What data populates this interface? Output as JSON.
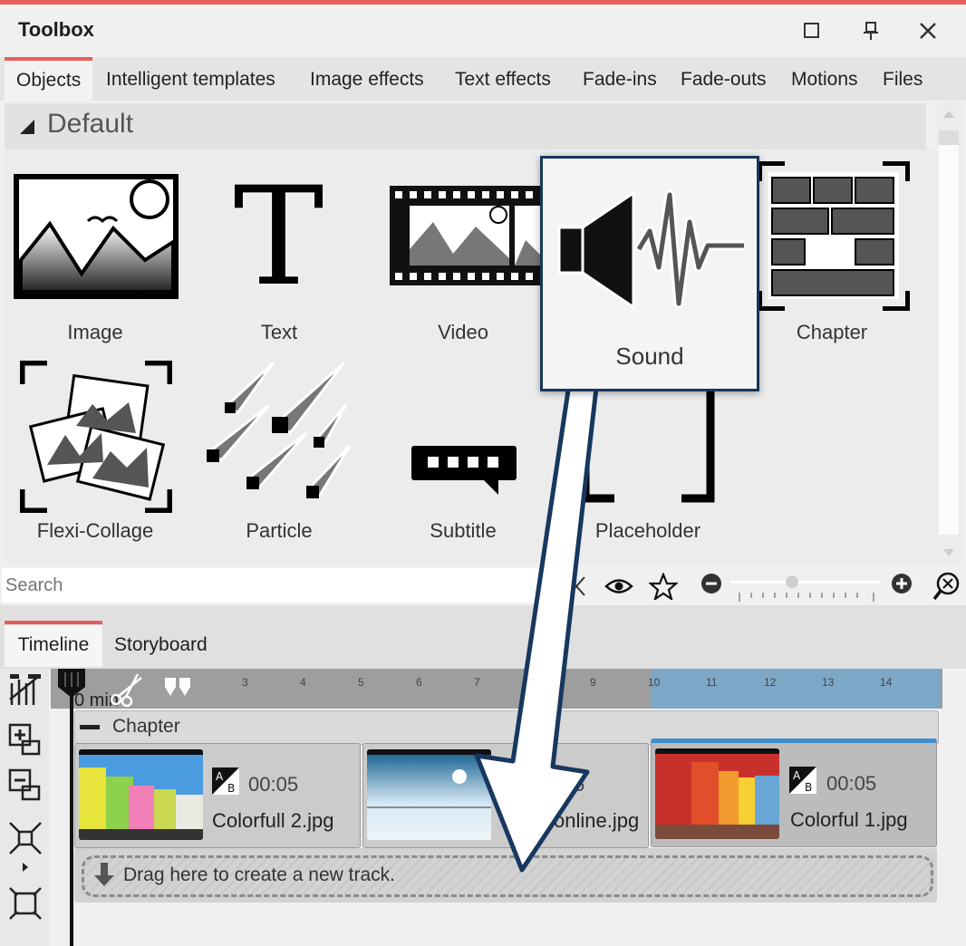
{
  "window": {
    "title": "Toolbox",
    "maximize_icon": "square-icon",
    "pin_icon": "pin-icon",
    "close_icon": "close-icon"
  },
  "tabs": [
    "Objects",
    "Intelligent templates",
    "Image effects",
    "Text effects",
    "Fade-ins",
    "Fade-outs",
    "Motions",
    "Files"
  ],
  "active_tab": "Objects",
  "group": {
    "label": "Default",
    "collapse_icon": "triangle-icon"
  },
  "objects": [
    {
      "label": "Image",
      "icon": "image-icon"
    },
    {
      "label": "Text",
      "icon": "text-icon"
    },
    {
      "label": "Video",
      "icon": "video-icon"
    },
    {
      "label": "Sound",
      "icon": "sound-icon"
    },
    {
      "label": "Chapter",
      "icon": "chapter-icon"
    },
    {
      "label": "Flexi-Collage",
      "icon": "collage-icon"
    },
    {
      "label": "Particle",
      "icon": "particle-icon"
    },
    {
      "label": "Subtitle",
      "icon": "subtitle-icon"
    },
    {
      "label": "Placeholder",
      "icon": "placeholder-icon"
    }
  ],
  "search": {
    "placeholder": "Search"
  },
  "lower_tabs": [
    "Timeline",
    "Storyboard"
  ],
  "timeline": {
    "ruler_label": "0 min",
    "ticks": [
      "3",
      "4",
      "5",
      "6",
      "7",
      "9",
      "10",
      "11",
      "12",
      "13",
      "14"
    ],
    "chapter_label": "Chapter",
    "clips": [
      {
        "duration": "00:05",
        "filename": "Colorfull 2.jpg",
        "selected": false
      },
      {
        "duration": "5",
        "filename": "online.jpg",
        "selected": false
      },
      {
        "duration": "00:05",
        "filename": "Colorful 1.jpg",
        "selected": true
      }
    ],
    "new_track": "Drag here to create a new track."
  },
  "colors": {
    "accent": "#e95c5c",
    "highlight": "#17375e",
    "selection": "#7da7c7"
  }
}
